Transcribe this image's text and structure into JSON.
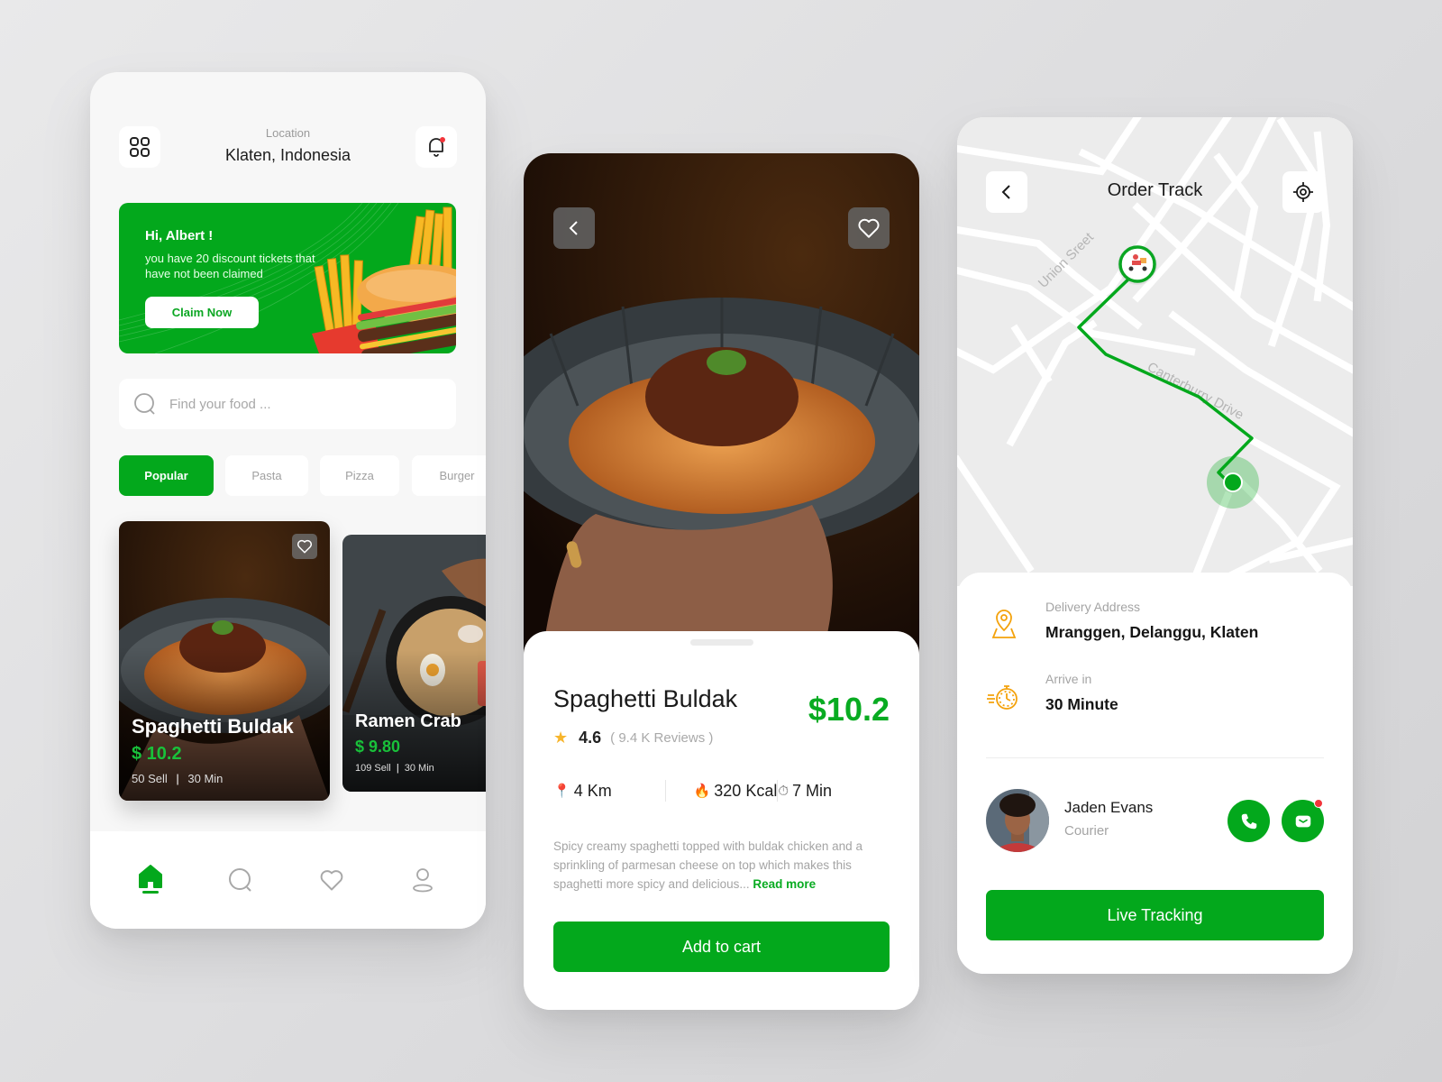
{
  "colors": {
    "brand_green": "#03a81c",
    "price_green": "#08ab21",
    "accent_orange": "#f4a20c",
    "notification_red": "#f2343a"
  },
  "home": {
    "menu_icon": "grid-icon",
    "location_label": "Location",
    "location_value": "Klaten, Indonesia",
    "notification_icon": "bell-icon",
    "promo": {
      "greeting": "Hi, Albert !",
      "message": "you have 20 discount tickets that have not been claimed",
      "button": "Claim Now"
    },
    "search": {
      "placeholder": "Find your food ...",
      "value": ""
    },
    "categories": [
      {
        "label": "Popular",
        "active": true
      },
      {
        "label": "Pasta",
        "active": false
      },
      {
        "label": "Pizza",
        "active": false
      },
      {
        "label": "Burger",
        "active": false
      }
    ],
    "foods": [
      {
        "name": "Spaghetti Buldak",
        "price": "$ 10.2",
        "sold": "50 Sell",
        "time": "30 Min"
      },
      {
        "name": "Ramen Crab",
        "price": "$ 9.80",
        "sold": "109 Sell",
        "time": "30 Min"
      }
    ],
    "nav": [
      {
        "name": "home",
        "icon": "home-icon",
        "active": true
      },
      {
        "name": "search",
        "icon": "search-icon",
        "active": false
      },
      {
        "name": "favorites",
        "icon": "heart-icon",
        "active": false
      },
      {
        "name": "profile",
        "icon": "user-icon",
        "active": false
      }
    ]
  },
  "detail": {
    "title": "Spaghetti Buldak",
    "price": "$10.2",
    "rating": "4.6",
    "reviews": "( 9.4 K Reviews )",
    "stats": [
      {
        "icon": "pin-icon",
        "glyph": "📍",
        "value": "4 Km"
      },
      {
        "icon": "fire-icon",
        "glyph": "🔥",
        "value": "320 Kcal"
      },
      {
        "icon": "stopwatch-icon",
        "glyph": "⏱",
        "value": "7 Min"
      }
    ],
    "description": "Spicy creamy spaghetti topped with buldak chicken and a sprinkling of parmesan cheese on top which makes this spaghetti more spicy and delicious...",
    "read_more": "Read more",
    "cta": "Add to cart"
  },
  "track": {
    "title": "Order Track",
    "streets": [
      "Union Sreet",
      "Canterburry Drive"
    ],
    "address_label": "Delivery Address",
    "address_value": "Mranggen, Delanggu, Klaten",
    "arrive_label": "Arrive in",
    "arrive_value": "30 Minute",
    "courier_name": "Jaden Evans",
    "courier_role": "Courier",
    "cta": "Live Tracking"
  }
}
